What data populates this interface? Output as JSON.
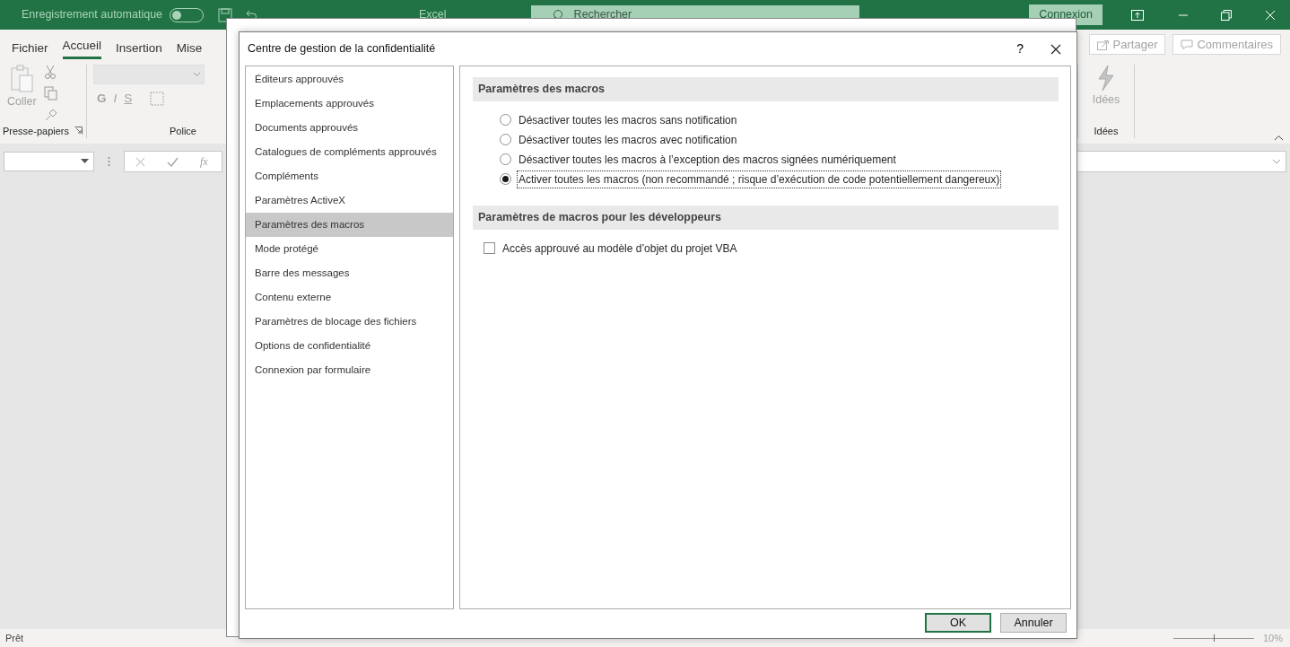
{
  "app": {
    "autosave_label": "Enregistrement automatique",
    "autosave_on": false,
    "title": "Excel",
    "search_placeholder": "Rechercher",
    "signin": "Connexion"
  },
  "ribbon_tabs": [
    {
      "label": "Fichier",
      "selected": false
    },
    {
      "label": "Accueil",
      "selected": true
    },
    {
      "label": "Insertion",
      "selected": false
    },
    {
      "label": "Mise",
      "selected": false
    }
  ],
  "ribbon_actions": [
    "Partager",
    "Commentaires"
  ],
  "ribbon": {
    "paste_label": "Coller",
    "clipboard_group": "Presse-papiers",
    "font_group": "Police",
    "format_buttons": [
      "G",
      "I",
      "S"
    ],
    "ideas_button": "Idées",
    "ideas_group": "Idées"
  },
  "formula_bar": {
    "function_label": "fx"
  },
  "status_bar": {
    "status": "Prêt",
    "zoom": "10%",
    "level": 0.5
  },
  "dialog": {
    "title": "Centre de gestion de la confidentialité",
    "help": "?",
    "categories": [
      {
        "label": "Éditeurs approuvés",
        "selected": false
      },
      {
        "label": "Emplacements approuvés",
        "selected": false
      },
      {
        "label": "Documents approuvés",
        "selected": false
      },
      {
        "label": "Catalogues de compléments approuvés",
        "selected": false
      },
      {
        "label": "Compléments",
        "selected": false
      },
      {
        "label": "Paramètres ActiveX",
        "selected": false
      },
      {
        "label": "Paramètres des macros",
        "selected": true
      },
      {
        "label": "Mode protégé",
        "selected": false
      },
      {
        "label": "Barre des messages",
        "selected": false
      },
      {
        "label": "Contenu externe",
        "selected": false
      },
      {
        "label": "Paramètres de blocage des fichiers",
        "selected": false
      },
      {
        "label": "Options de confidentialité",
        "selected": false
      },
      {
        "label": "Connexion par formulaire",
        "selected": false
      }
    ],
    "sections": [
      {
        "heading": "Paramètres des macros",
        "options": [
          {
            "kind": "radio",
            "label": "Désactiver toutes les macros sans notification",
            "selected": false,
            "focused": false
          },
          {
            "kind": "radio",
            "label": "Désactiver toutes les macros avec notification",
            "selected": false,
            "focused": false
          },
          {
            "kind": "radio",
            "label": "Désactiver toutes les macros à l’exception des macros signées numériquement",
            "selected": false,
            "focused": false
          },
          {
            "kind": "radio",
            "label": "Activer toutes les macros (non recommandé ; risque d’exécution de code potentiellement dangereux)",
            "selected": true,
            "focused": true
          }
        ]
      },
      {
        "heading": "Paramètres de macros pour les développeurs",
        "options": [
          {
            "kind": "checkbox",
            "label": "Accès approuvé au modèle d’objet du projet VBA",
            "checked": false,
            "focused": false
          }
        ]
      }
    ],
    "buttons": [
      {
        "label": "OK",
        "default": true
      },
      {
        "label": "Annuler",
        "default": false
      }
    ]
  }
}
